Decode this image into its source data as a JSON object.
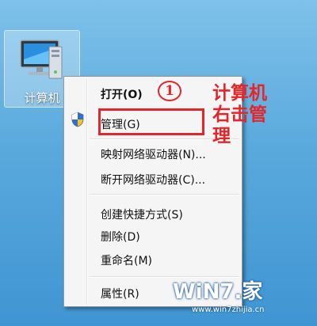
{
  "desktop": {
    "computer_icon": {
      "label": "计算机",
      "icon": "computer-monitor-icon"
    }
  },
  "context_menu": {
    "items": [
      {
        "label": "打开(O)",
        "bold": true
      },
      {
        "label": "管理(G)",
        "icon": "uac-shield-icon"
      },
      {
        "label": "映射网络驱动器(N)..."
      },
      {
        "label": "断开网络驱动器(C)..."
      },
      {
        "label": "创建快捷方式(S)"
      },
      {
        "label": "删除(D)"
      },
      {
        "label": "重命名(M)"
      },
      {
        "label": "属性(R)"
      }
    ]
  },
  "annotation": {
    "step_number": "1",
    "note": "计算机\n右击管\n理",
    "color": "#e4262b"
  },
  "watermark": {
    "logo_text": "WiN7.家",
    "url": "www.win7zhijia.cn"
  }
}
